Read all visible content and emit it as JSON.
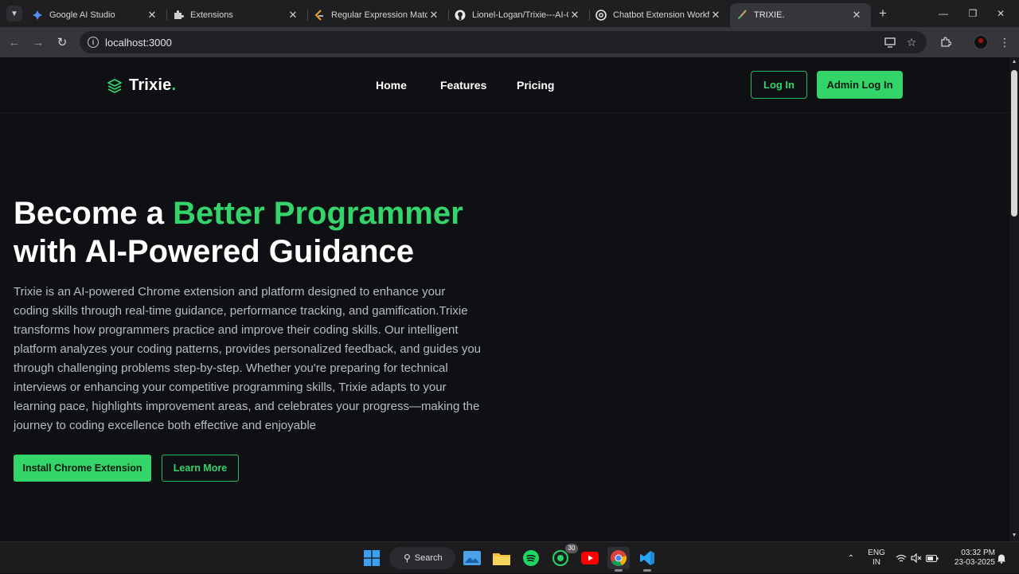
{
  "browser": {
    "tabs": [
      {
        "title": "Google AI Studio",
        "icon": "ai-studio-icon"
      },
      {
        "title": "Extensions",
        "icon": "puzzle-icon"
      },
      {
        "title": "Regular Expression Matchi",
        "icon": "leetcode-icon"
      },
      {
        "title": "Lionel-Logan/Trixie---AI-Cl",
        "icon": "github-icon"
      },
      {
        "title": "Chatbot Extension Workflo",
        "icon": "chatgpt-icon"
      },
      {
        "title": "TRIXIE.",
        "icon": "brush-icon",
        "active": true
      }
    ],
    "url": "localhost:3000"
  },
  "site": {
    "logo_name": "Trixie",
    "logo_dot": ".",
    "nav": [
      "Home",
      "Features",
      "Pricing"
    ],
    "login_label": "Log In",
    "admin_login_label": "Admin Log In",
    "hero": {
      "title_part1": "Become a ",
      "title_accent": "Better Programmer",
      "title_part2": "with AI-Powered Guidance",
      "description": "Trixie is an AI-powered Chrome extension and platform designed to enhance your coding skills through real-time guidance, performance tracking, and gamification.Trixie transforms how programmers practice and improve their coding skills. Our intelligent platform analyzes your coding patterns, provides personalized feedback, and guides you through challenging problems step-by-step. Whether you're preparing for technical interviews or enhancing your competitive programming skills, Trixie adapts to your learning pace, highlights improvement areas, and celebrates your progress—making the journey to coding excellence both effective and enjoyable",
      "install_label": "Install Chrome Extension",
      "learn_label": "Learn More"
    },
    "colors": {
      "accent": "#34d46a",
      "background": "#0e1014"
    }
  },
  "taskbar": {
    "search_label": "Search",
    "whatsapp_badge": "30",
    "lang_line1": "ENG",
    "lang_line2": "IN",
    "time": "03:32 PM",
    "date": "23-03-2025"
  }
}
